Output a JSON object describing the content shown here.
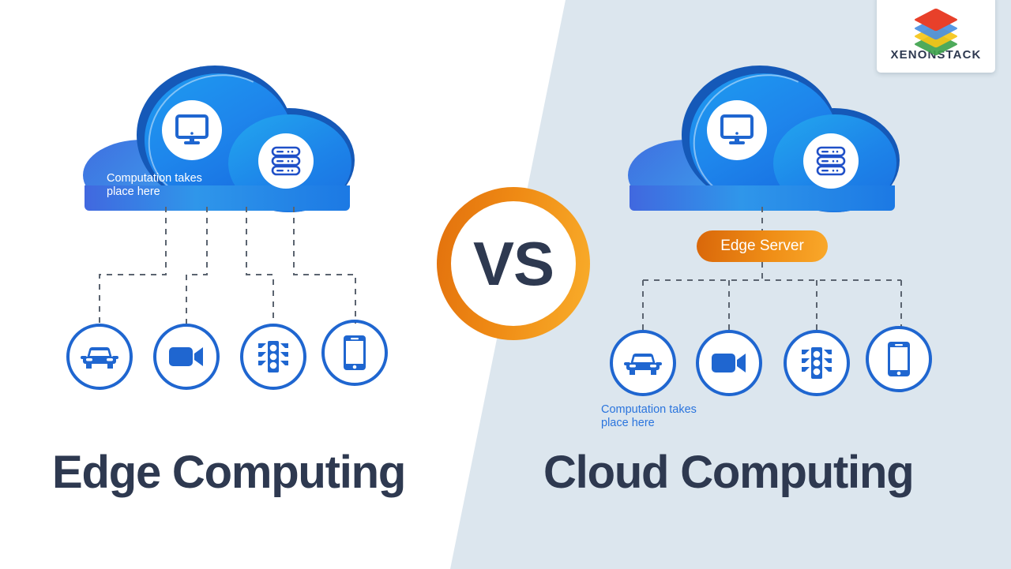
{
  "brand": {
    "name": "XENONSTACK",
    "logo_icon": "stacked-layers-icon",
    "layer_colors": [
      "#e8402a",
      "#4a90e2",
      "#f5c518",
      "#3fa34d"
    ]
  },
  "theme": {
    "left_background": "#ffffff",
    "right_background": "#dce6ee",
    "cloud_blue": "#1e86ec",
    "cloud_rim": "#1559b8",
    "device_blue": "#1f66d0",
    "accent_orange": "#ef8d16",
    "heading_navy": "#2e3950",
    "label_blue": "#2a74dd"
  },
  "center": {
    "vs_label": "VS"
  },
  "left_panel": {
    "heading": "Edge Computing",
    "cloud": {
      "name": "edge-cloud",
      "label": "Computation takes\nplace here",
      "label_color": "#ffffff",
      "icons": [
        "monitor-icon",
        "server-icon"
      ]
    },
    "devices": [
      {
        "name": "car",
        "icon": "car-icon"
      },
      {
        "name": "camera",
        "icon": "video-camera-icon"
      },
      {
        "name": "traffic-light",
        "icon": "traffic-light-icon"
      },
      {
        "name": "phone",
        "icon": "smartphone-icon"
      }
    ]
  },
  "right_panel": {
    "heading": "Cloud Computing",
    "cloud": {
      "name": "cloud-datacenter",
      "label": "",
      "icons": [
        "monitor-icon",
        "server-icon"
      ]
    },
    "edge_server": {
      "label": "Edge Server"
    },
    "computation_label": "Computation takes\nplace here",
    "computation_label_color": "#2a74dd",
    "devices": [
      {
        "name": "car",
        "icon": "car-icon"
      },
      {
        "name": "camera",
        "icon": "video-camera-icon"
      },
      {
        "name": "traffic-light",
        "icon": "traffic-light-icon"
      },
      {
        "name": "phone",
        "icon": "smartphone-icon"
      }
    ]
  }
}
